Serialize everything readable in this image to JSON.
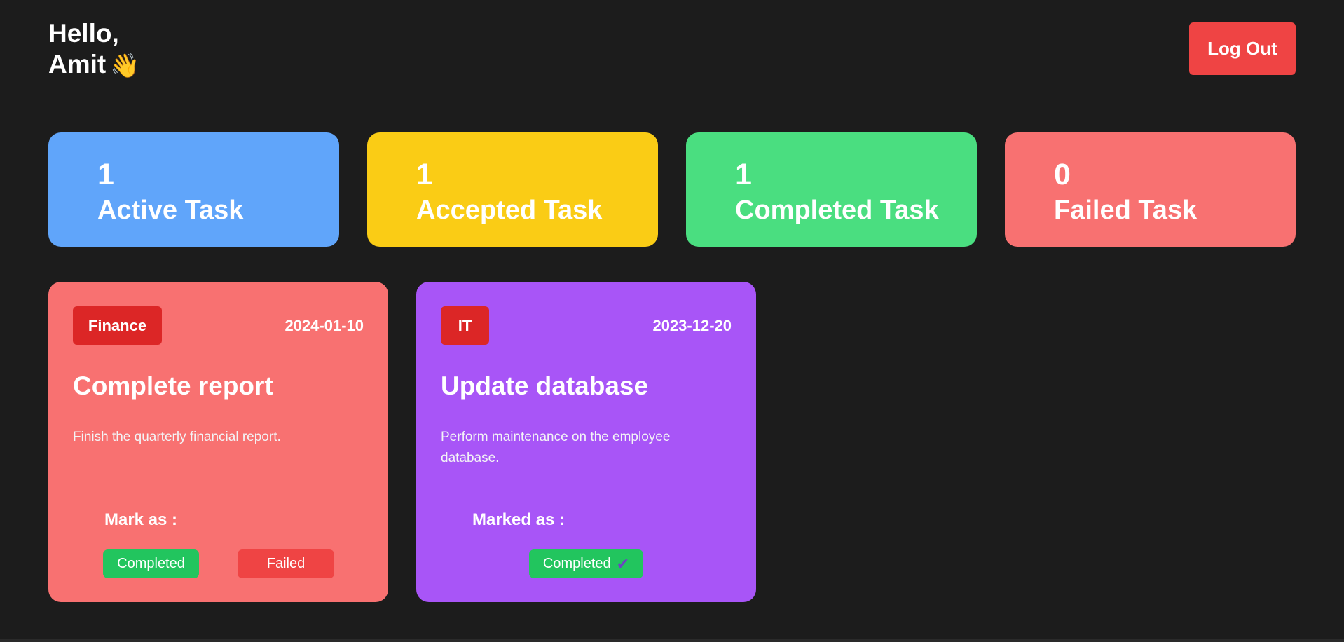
{
  "header": {
    "greeting_line1": "Hello,",
    "greeting_name": "Amit",
    "wave_icon": "👋",
    "logout_label": "Log Out"
  },
  "stats": [
    {
      "count": "1",
      "label": "Active Task",
      "color": "#60a5fa"
    },
    {
      "count": "1",
      "label": "Accepted Task",
      "color": "#facc15"
    },
    {
      "count": "1",
      "label": "Completed Task",
      "color": "#4ade80"
    },
    {
      "count": "0",
      "label": "Failed Task",
      "color": "#f87171"
    }
  ],
  "tasks": [
    {
      "category": "Finance",
      "date": "2024-01-10",
      "title": "Complete report",
      "description": "Finish the quarterly financial report.",
      "mark_label": "Mark as :",
      "completed_label": "Completed",
      "failed_label": "Failed",
      "color": "#f87171"
    },
    {
      "category": "IT",
      "date": "2023-12-20",
      "title": "Update database",
      "description": "Perform maintenance on the employee database.",
      "mark_label": "Marked as :",
      "completed_label": "Completed",
      "check_icon": "✔",
      "color": "#a855f7"
    }
  ],
  "colors": {
    "background": "#1c1c1c",
    "logout": "#ef4444",
    "badge": "#dc2626",
    "success": "#22c55e",
    "danger": "#ef4444"
  }
}
